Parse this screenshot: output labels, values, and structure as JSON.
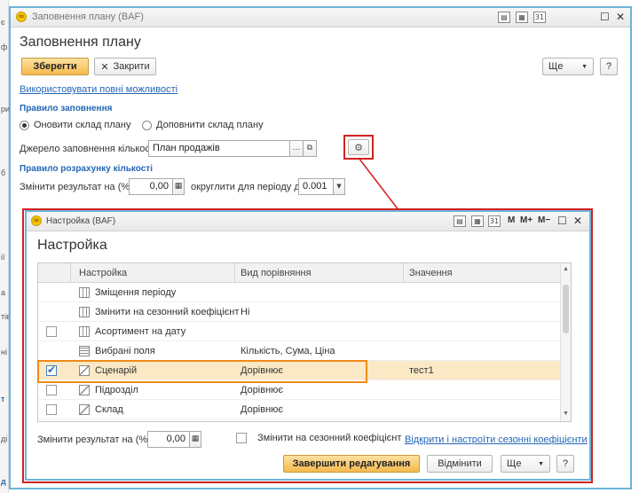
{
  "background_strip": {
    "chars": [
      "є",
      "ф",
      "ри",
      "б",
      "ії",
      "а",
      "тів",
      "ні",
      "т",
      "ді",
      "д"
    ]
  },
  "main_window": {
    "title": "Заповнення плану (BAF)",
    "heading": "Заповнення плану",
    "save_label": "Зберегти",
    "close_label": "Закрити",
    "more_label": "Ще",
    "help_label": "?",
    "full_features_link": "Використовувати повні можливості",
    "fill_rule_section": "Правило заповнення",
    "radio_update": "Оновити склад плану",
    "radio_add": "Доповнити склад плану",
    "source_label": "Джерело заповнення кількості:",
    "source_value": "План продажів",
    "calc_rule_section": "Правило розрахунку кількості",
    "change_result_label": "Змінити результат на (%):",
    "change_result_value": "0,00",
    "round_label": "округлити для періоду до:",
    "round_value": "0.001"
  },
  "dialog": {
    "title": "Настройка (BAF)",
    "heading": "Настройка",
    "toolbar_m": "M",
    "toolbar_mplus": "M+",
    "toolbar_mminus": "M−",
    "columns": [
      "Настройка",
      "Вид порівняння",
      "Значення"
    ],
    "rows": [
      {
        "has_checkbox": false,
        "checked": false,
        "icon": "period-icon",
        "setting": "Зміщення періоду",
        "comparison": "",
        "value": ""
      },
      {
        "has_checkbox": false,
        "checked": false,
        "icon": "period-icon",
        "setting": "Змінити на сезонний коефіцієнт",
        "comparison": "Ні",
        "value": ""
      },
      {
        "has_checkbox": true,
        "checked": false,
        "icon": "period-icon",
        "setting": "Асортимент на дату",
        "comparison": "",
        "value": ""
      },
      {
        "has_checkbox": false,
        "checked": false,
        "icon": "fields-list-icon",
        "setting": "Вибрані поля",
        "comparison": "Кількість, Сума, Ціна",
        "value": ""
      },
      {
        "has_checkbox": true,
        "checked": true,
        "icon": "reference-icon",
        "setting": "Сценарій",
        "comparison": "Дорівнює",
        "value": "тест1"
      },
      {
        "has_checkbox": true,
        "checked": false,
        "icon": "reference-icon",
        "setting": "Підрозділ",
        "comparison": "Дорівнює",
        "value": ""
      },
      {
        "has_checkbox": true,
        "checked": false,
        "icon": "reference-icon",
        "setting": "Склад",
        "comparison": "Дорівнює",
        "value": ""
      }
    ],
    "change_result_label": "Змінити результат на (%):",
    "change_result_value": "0,00",
    "seasonal_checkbox_label": "Змінити на сезонний коефіцієнт",
    "seasonal_link": "Відкрити і настроїти сезонні коефіцієнти",
    "finish_label": "Завершити редагування",
    "cancel_label": "Відмінити",
    "more_label": "Ще",
    "help_label": "?"
  },
  "colors": {
    "accent": "#2467b5",
    "highlight_red": "#d42020",
    "highlight_orange": "#ef8a18",
    "primary_button": "#f5b94f",
    "window_border": "#6cb4d9"
  }
}
